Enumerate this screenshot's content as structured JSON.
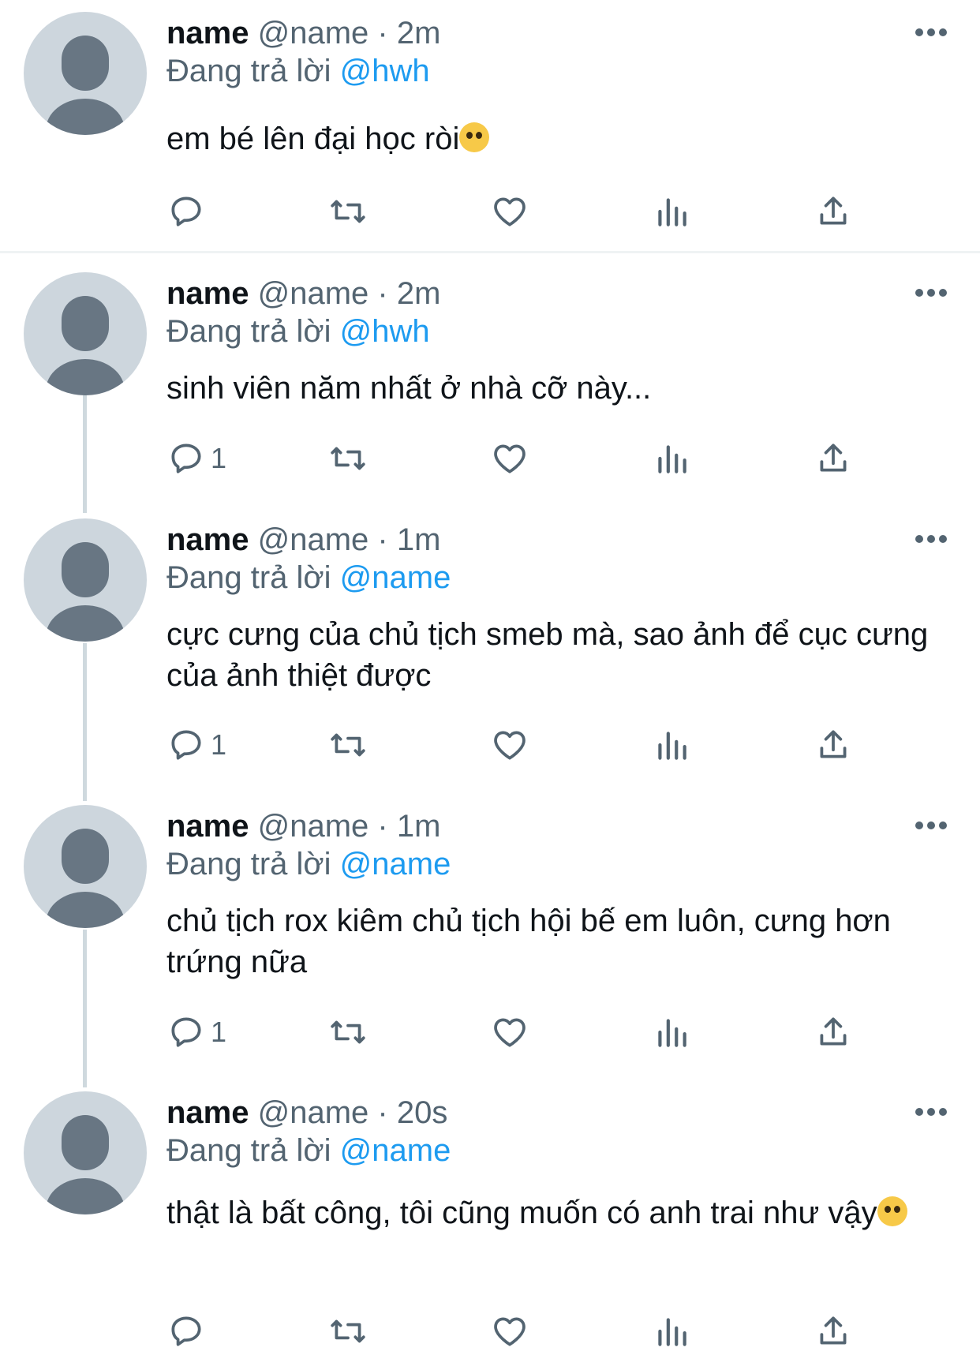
{
  "tweets": [
    {
      "name": "name",
      "handle": "@name",
      "time": "2m",
      "reply_prefix": "Đang trả lời",
      "reply_to": "@hwh",
      "text": "em bé lên đại học ròi",
      "emoji": "pleading-face-emoji",
      "reply_count": ""
    },
    {
      "name": "name",
      "handle": "@name",
      "time": "2m",
      "reply_prefix": "Đang trả lời",
      "reply_to": "@hwh",
      "text": "sinh viên năm nhất ở nhà cỡ này...",
      "reply_count": "1"
    },
    {
      "name": "name",
      "handle": "@name",
      "time": "1m",
      "reply_prefix": "Đang trả lời",
      "reply_to": "@name",
      "text": "cực cưng của chủ tịch smeb mà, sao ảnh để cục cưng của ảnh thiệt được",
      "reply_count": "1"
    },
    {
      "name": "name",
      "handle": "@name",
      "time": "1m",
      "reply_prefix": "Đang trả lời",
      "reply_to": "@name",
      "text": "chủ tịch rox kiêm chủ tịch hội bế em luôn, cưng hơn trứng nữa",
      "reply_count": "1"
    },
    {
      "name": "name",
      "handle": "@name",
      "time": "20s",
      "reply_prefix": "Đang trả lời",
      "reply_to": "@name",
      "text": "thật là bất công, tôi cũng muốn có anh trai như vậy",
      "emoji": "loudly-crying-face-emoji",
      "reply_count": ""
    }
  ],
  "colors": {
    "accent": "#1d9bf0",
    "text": "#0f1419",
    "secondary": "#536471",
    "avatar_bg": "#cdd6dd",
    "avatar_fg": "#687683"
  }
}
